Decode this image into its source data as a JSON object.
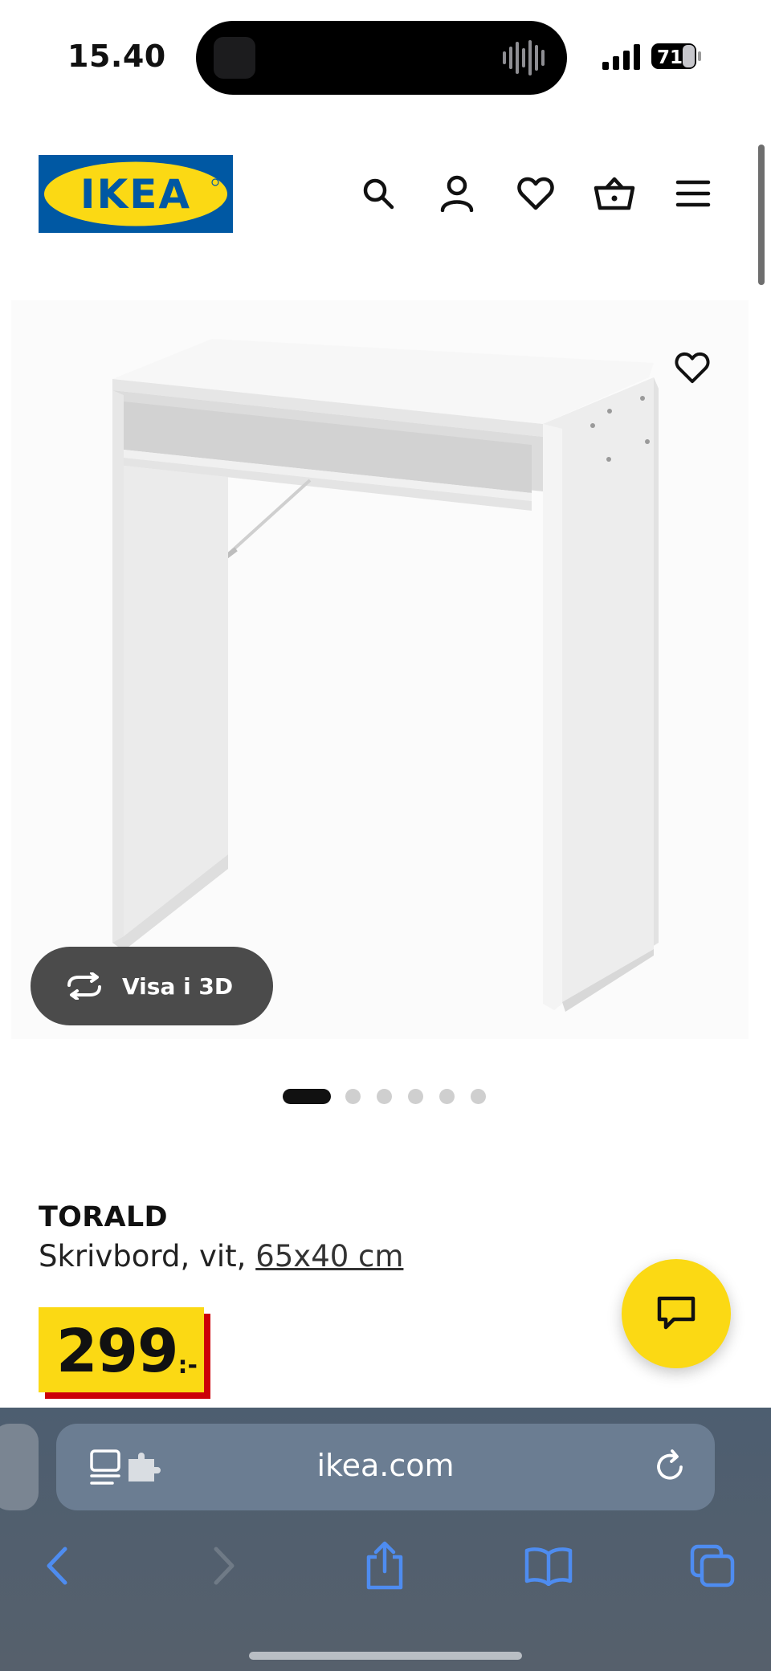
{
  "status_bar": {
    "time": "15.40",
    "battery": "71"
  },
  "header": {
    "logo_text": "IKEA",
    "icons": [
      "search-icon",
      "account-icon",
      "wishlist-icon",
      "basket-icon",
      "menu-icon"
    ]
  },
  "product": {
    "image_alt": "TORALD desk",
    "view_3d_label": "Visa i 3D",
    "carousel": {
      "count": 6,
      "active": 1
    },
    "name": "TORALD",
    "description": "Skrivbord, vit,",
    "size": "65x40 cm",
    "price": "299",
    "price_suffix": ":-"
  },
  "browser": {
    "url": "ikea.com",
    "nav_icons": [
      "back-icon",
      "forward-icon",
      "share-icon",
      "bookmarks-icon",
      "tabs-icon"
    ]
  },
  "colors": {
    "ikea_blue": "#0058a3",
    "ikea_yellow": "#fbd914",
    "price_red": "#cc0008",
    "safari_accent": "#4e8cf0"
  }
}
